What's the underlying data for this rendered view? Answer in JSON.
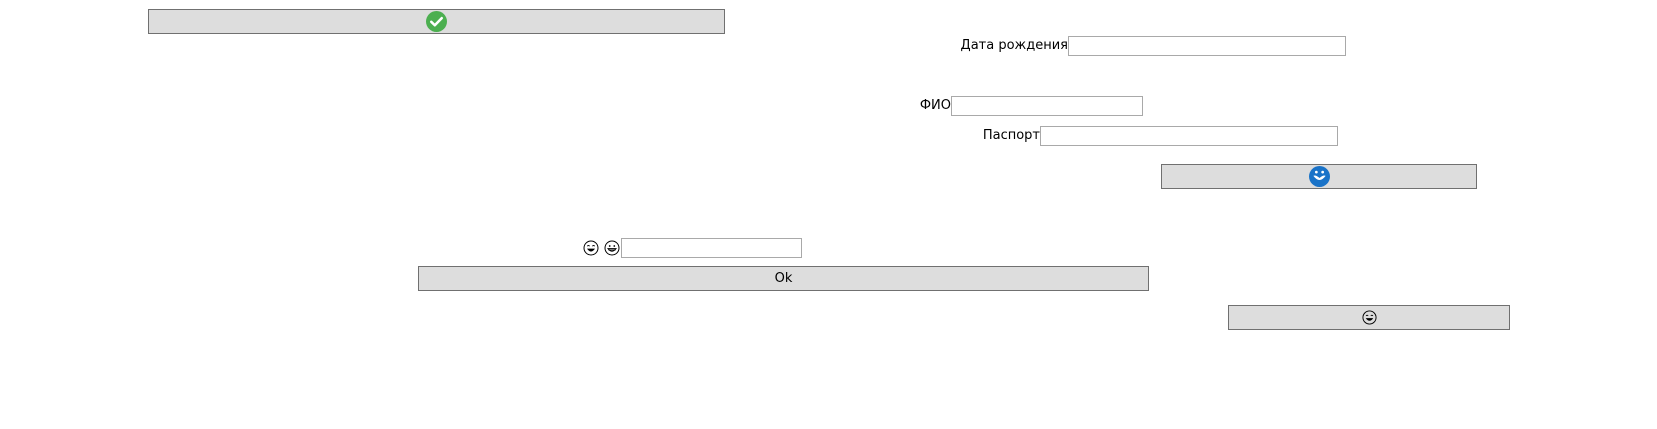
{
  "top_button": {
    "icon": "check-circle-icon",
    "color": "#4caf50"
  },
  "birth_date": {
    "label": "Дата рождения",
    "value": ""
  },
  "fio": {
    "label": "ФИО",
    "value": ""
  },
  "passport": {
    "label": "Паспорт",
    "value": ""
  },
  "blue_button": {
    "icon": "blue-smiley-icon",
    "color": "#1a73c8"
  },
  "emoji_row": {
    "icons": [
      "laughing-emoji-icon",
      "grinning-emoji-icon"
    ],
    "value": ""
  },
  "ok_button": {
    "label": "Ok"
  },
  "emoji_button": {
    "icon": "laughing-emoji-icon"
  }
}
